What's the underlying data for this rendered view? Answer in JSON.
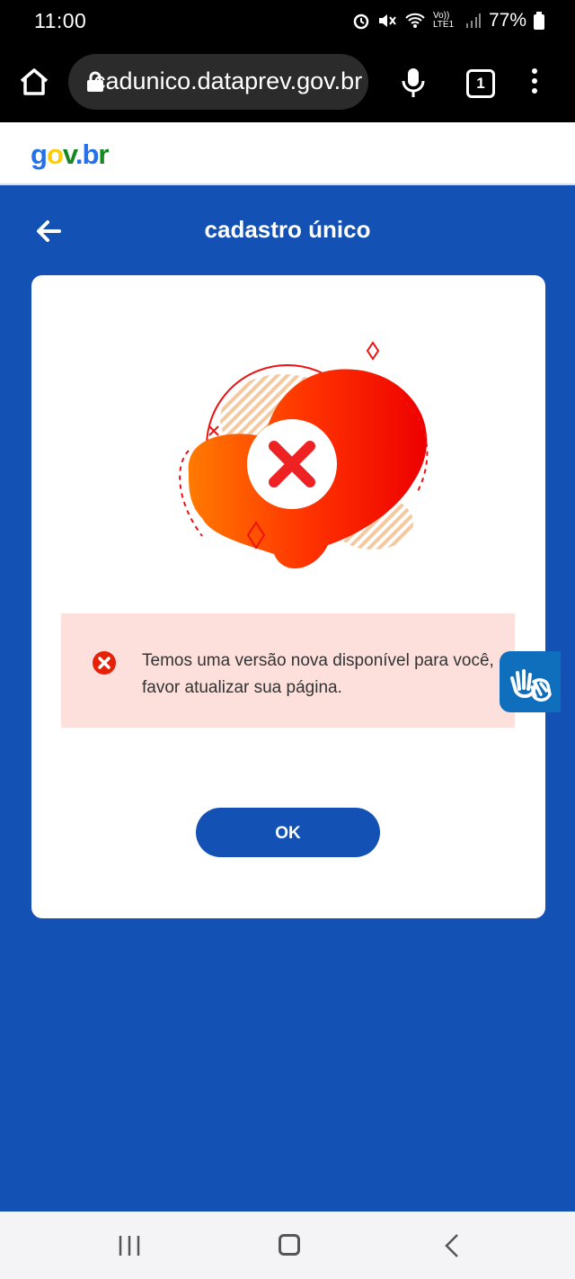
{
  "status_bar": {
    "time": "11:00",
    "network_label": "Vo)) LTE1",
    "battery": "77%"
  },
  "browser": {
    "url": "cadunico.dataprev.gov.br",
    "tab_count": "1"
  },
  "gov_logo": {
    "g": "g",
    "o": "o",
    "v": "v",
    "dot": ".",
    "b": "b",
    "r": "r"
  },
  "header": {
    "title": "cadastro único"
  },
  "alert": {
    "message": "Temos uma versão nova disponível para você, favor atualizar sua página."
  },
  "dialog": {
    "ok_label": "OK"
  },
  "colors": {
    "primary": "#1351b4",
    "alert_bg": "#fde0db",
    "error_red": "#e52207"
  },
  "icons": [
    "home-icon",
    "lock-icon",
    "mic-icon",
    "tabs-icon",
    "more-icon",
    "back-arrow-icon",
    "error-illustration",
    "error-icon",
    "vlibras-hand-icon",
    "recents-icon",
    "nav-home-icon",
    "nav-back-icon"
  ]
}
